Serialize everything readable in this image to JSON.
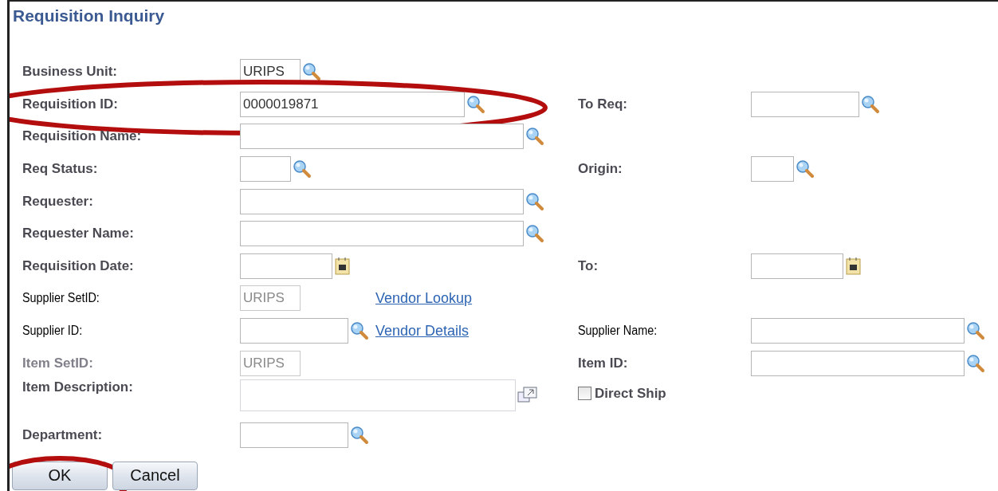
{
  "title": "Requisition Inquiry",
  "rows": [
    {
      "label": {
        "text": "Business Unit:",
        "kind": "bold"
      },
      "field": {
        "kind": "text",
        "value": "URIPS",
        "disabled": false
      },
      "lookup": true,
      "highlighted": false
    },
    {
      "label": {
        "text": "Requisition ID:",
        "kind": "bold"
      },
      "field": {
        "kind": "text",
        "value": "0000019871",
        "disabled": false
      },
      "lookup": true,
      "highlighted": true,
      "right": {
        "kind": "field",
        "label": {
          "text": "To Req:",
          "kind": "bold"
        },
        "field": {
          "kind": "text",
          "disabled": false
        },
        "lookup": true
      }
    },
    {
      "label": {
        "text": "Requisition Name:",
        "kind": "bold"
      },
      "field": {
        "kind": "text",
        "disabled": false
      },
      "lookup": true,
      "highlighted": false
    },
    {
      "label": {
        "text": "Req Status:",
        "kind": "bold"
      },
      "field": {
        "kind": "text",
        "disabled": false
      },
      "lookup": true,
      "highlighted": false,
      "right": {
        "kind": "field",
        "label": {
          "text": "Origin:",
          "kind": "bold"
        },
        "field": {
          "kind": "text",
          "disabled": false
        },
        "lookup": true
      }
    },
    {
      "label": {
        "text": "Requester:",
        "kind": "bold"
      },
      "field": {
        "kind": "text",
        "disabled": false
      },
      "lookup": true,
      "highlighted": false
    },
    {
      "label": {
        "text": "Requester Name:",
        "kind": "bold"
      },
      "field": {
        "kind": "text",
        "disabled": false
      },
      "lookup": true,
      "highlighted": false
    },
    {
      "label": {
        "text": "Requisition Date:",
        "kind": "bold"
      },
      "field": {
        "kind": "text",
        "disabled": false
      },
      "calendar": true,
      "highlighted": false,
      "right": {
        "kind": "field",
        "label": {
          "text": "To:",
          "kind": "bold"
        },
        "field": {
          "kind": "text",
          "disabled": false
        },
        "calendar": true
      }
    },
    {
      "label": {
        "text": "Supplier SetID:",
        "kind": "plain"
      },
      "field": {
        "kind": "text",
        "value": "URIPS",
        "disabled": true
      },
      "link": "Vendor Lookup",
      "highlighted": false
    },
    {
      "label": {
        "text": "Supplier ID:",
        "kind": "plain"
      },
      "field": {
        "kind": "text",
        "disabled": false
      },
      "lookup": true,
      "link": "Vendor Details",
      "highlighted": false,
      "right": {
        "kind": "field",
        "label": {
          "text": "Supplier Name:",
          "kind": "plain"
        },
        "field": {
          "kind": "text",
          "disabled": false
        },
        "lookup": true
      }
    },
    {
      "label": {
        "text": "Item SetID:",
        "kind": "muted"
      },
      "field": {
        "kind": "text",
        "value": "URIPS",
        "disabled": true
      },
      "highlighted": false,
      "right": {
        "kind": "field",
        "label": {
          "text": "Item ID:",
          "kind": "bold"
        },
        "field": {
          "kind": "text",
          "disabled": false
        },
        "lookup": true
      }
    },
    {
      "label": {
        "text": "Item Description:",
        "kind": "bold"
      },
      "field": {
        "kind": "textarea",
        "disabled": true
      },
      "expand": true,
      "highlighted": false,
      "right": {
        "kind": "checkbox",
        "label": {
          "text": "Direct Ship",
          "kind": "bold"
        },
        "checked": false
      }
    },
    {
      "label": {
        "text": "Department:",
        "kind": "bold"
      },
      "field": {
        "kind": "text",
        "disabled": false
      },
      "lookup": true,
      "highlighted": false
    }
  ],
  "buttons": [
    {
      "label": "OK",
      "highlighted": true
    },
    {
      "label": "Cancel",
      "highlighted": false
    }
  ]
}
